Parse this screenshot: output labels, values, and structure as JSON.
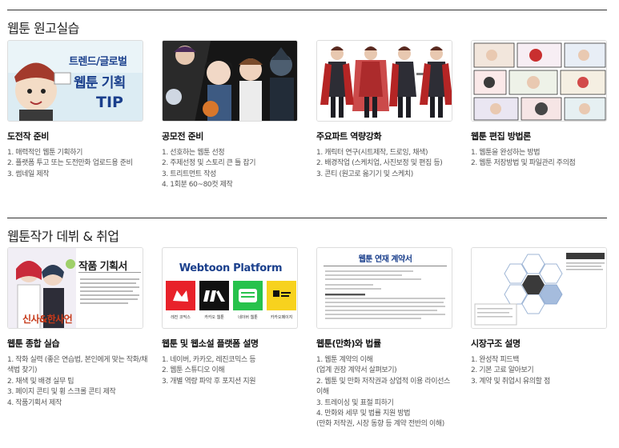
{
  "sections": [
    {
      "title": "웹툰 원고실습",
      "cards": [
        {
          "title": "도전작 준비",
          "thumb_text": [
            "트렌드/글로벌",
            "웹툰 기획",
            "TIP"
          ],
          "items": [
            "1. 매력적인 웹툰 기획하기",
            "2. 플랫폼 투고 또는 도전만화 업로드용 준비",
            "3. 썸네일 제작"
          ]
        },
        {
          "title": "공모전 준비",
          "items": [
            "1. 선호하는 웹툰 선정",
            "2. 주제선정 및 스토리 큰 틀 잡기",
            "3. 트리트먼트 작성",
            "4. 1회분 60~80컷 제작"
          ]
        },
        {
          "title": "주요파트 역량강화",
          "items": [
            "1. 캐릭터 연구(시트제작, 드로잉, 채색)",
            "2. 배경작업 (스케치업, 사진보정 및 편집 등)",
            "3. 콘티 (원고로 옮기기 및 스케치)"
          ]
        },
        {
          "title": "웹툰 편집 방법론",
          "items": [
            "1. 웹툰을 완성하는 방법",
            "2. 웹툰 저장방법 및 파일관리 주의점"
          ]
        }
      ]
    },
    {
      "title": "웹툰작가 데뷔 & 취업",
      "cards": [
        {
          "title": "웹툰 종합 실습",
          "thumb_text": [
            "작품 기획서",
            "신사&한사언"
          ],
          "items": [
            "1. 작화 실력 (좋은 연습법, 본인에게 맞는 작화/채",
            "색법 찾기)",
            "2. 채색 및 배경 실무 팁",
            "3. 페이지 콘티 및 휭 스크롤 콘티 제작",
            "4. 작품기획서 제작"
          ]
        },
        {
          "title": "웹툰 및 웹소설 플랫폼 설명",
          "thumb_text": [
            "Webtoon Platform"
          ],
          "platforms": [
            "레진 코믹스",
            "카카오 웹툰",
            "네이버 웹툰",
            "카카오페이지"
          ],
          "items": [
            "1. 네이버, 카카오, 레진코믹스 등",
            "2. 웹툰 스튜디오 이해",
            "3. 개별 역량 파악 후 포지션 지원"
          ]
        },
        {
          "title": "웹툰(만화)와 법률",
          "thumb_text": [
            "웹툰 연재 계약서"
          ],
          "items": [
            "1. 웹툰 계약의 이해",
            "(업계 권장 계약서 살펴보기)",
            "2. 웹툰 및 만화 저작권과 상업적 이용 라이선스",
            "이해",
            "3. 트레이싱 및 표절 피하기",
            "4. 만화와 세무 및 법률 지원 방법",
            "(만화 저작권, 시장 동향 등 계약 전반의 이해)"
          ]
        },
        {
          "title": "시장구조 설명",
          "items": [
            "1. 완성작 피드백",
            "2. 기본 고료 알아보기",
            "3. 계약 및 취업시 유의할 점"
          ]
        }
      ]
    }
  ],
  "colors": {
    "accent_blue": "#1a3f8c",
    "platform_red": "#e8222a",
    "platform_black": "#111111",
    "platform_green": "#27c24c",
    "platform_yellow": "#f7d21e"
  }
}
